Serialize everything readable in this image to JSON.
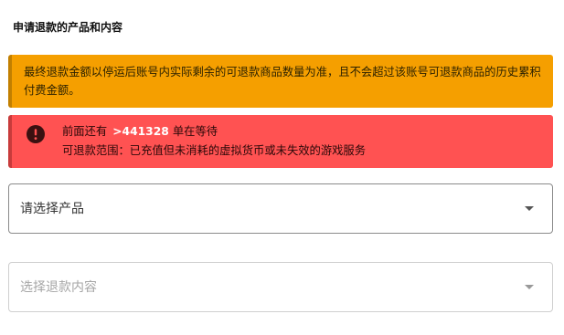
{
  "section": {
    "title": "申请退款的产品和内容"
  },
  "warning": {
    "text": "最终退款金额以停运后账号内实际剩余的可退款商品数量为准，且不会超过该账号可退款商品的历史累积付费金额。"
  },
  "error": {
    "icon": "exclamation-circle-icon",
    "queue_prefix": "前面还有",
    "queue_count": ">441328",
    "queue_suffix": "单在等待",
    "scope_text": "可退款范围：已充值但未消耗的虚拟货币或未失效的游戏服务"
  },
  "product_select": {
    "placeholder": "请选择产品",
    "icon": "caret-down-icon"
  },
  "content_select": {
    "placeholder": "选择退款内容",
    "icon": "caret-down-icon"
  },
  "colors": {
    "warning_bg": "#f59f00",
    "error_bg": "#ff5252"
  }
}
